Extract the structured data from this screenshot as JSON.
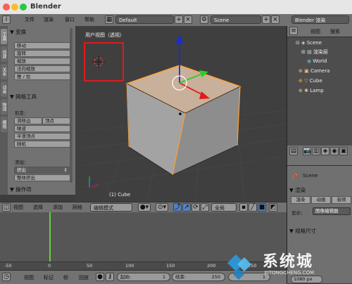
{
  "app": {
    "title": "Blender"
  },
  "info_header": {
    "menus": [
      "文件",
      "渲染",
      "窗口",
      "帮助"
    ],
    "screen_layout": "Default",
    "scene": "Scene",
    "render_engine": "Blender 渲染"
  },
  "toolshelf": {
    "tabs": [
      "工具",
      "创建",
      "关系",
      "动画",
      "物理",
      "栅格"
    ],
    "transform": {
      "title": "变换",
      "buttons": [
        "移动",
        "旋转",
        "缩放",
        "法向缩放",
        "推 / 拉"
      ]
    },
    "mesh_tools": {
      "title": "网格工具",
      "deform_label": "形变：",
      "row1": [
        "滑移边",
        "顶点"
      ],
      "buttons": [
        "噪波",
        "平滑顶点",
        "随机"
      ],
      "add_label": "添加：",
      "extrude": "挤出",
      "extrude_all": "整体挤出"
    },
    "operator_panel": "操作项"
  },
  "viewport": {
    "view_label": "用户视图（透视）",
    "object_label": "(1) Cube"
  },
  "outliner": {
    "menus": [
      "视图",
      "搜索"
    ],
    "items": [
      {
        "label": "Scene",
        "icon": "scene-icon"
      },
      {
        "label": "渲染层",
        "icon": "render-layer-icon"
      },
      {
        "label": "World",
        "icon": "world-icon"
      },
      {
        "label": "Camera",
        "icon": "camera-icon"
      },
      {
        "label": "Cube",
        "icon": "cube-icon"
      },
      {
        "label": "Lamp",
        "icon": "lamp-icon"
      }
    ]
  },
  "properties": {
    "scene_label": "Scene",
    "render_section": "渲染",
    "tabs": [
      "渲染",
      "动画",
      "音频"
    ],
    "display_label": "显示：",
    "display_value": "图像编辑器",
    "dimensions_section": "规格尺寸",
    "resolution_value": "1080 px"
  },
  "viewport_header": {
    "menus": [
      "视图",
      "选择",
      "添加",
      "网格"
    ],
    "mode": "编辑模式",
    "pivot": "全局"
  },
  "timeline": {
    "ticks": [
      "-50",
      "0",
      "50",
      "100",
      "150",
      "200",
      "250"
    ],
    "current_frame_marker": 0,
    "menus": [
      "视图",
      "标记",
      "帧",
      "回放"
    ],
    "start_label": "起始:",
    "start_value": "1",
    "end_label": "结束:",
    "end_value": "250",
    "current_value": "1"
  },
  "watermark": {
    "text": "系统城",
    "url": "XITONGCHENG.COM"
  },
  "colors": {
    "selected_orange": "#ffa43a",
    "cube_face": "#c9b09b",
    "frame_green": "#5fd23c",
    "red_box": "#e0191e"
  }
}
